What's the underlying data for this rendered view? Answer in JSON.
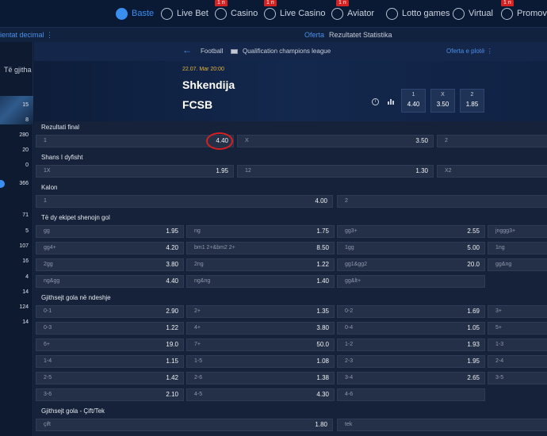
{
  "topnav": [
    {
      "label": "Baste",
      "icon": "soccer-ball-icon",
      "active": true,
      "badge": ""
    },
    {
      "label": "Live Bet",
      "icon": "live-bet-icon",
      "active": false,
      "badge": ""
    },
    {
      "label": "Casino",
      "icon": "casino-chips-icon",
      "active": false,
      "badge": "1 ri"
    },
    {
      "label": "Live Casino",
      "icon": "live-casino-icon",
      "active": false,
      "badge": "1 ri"
    },
    {
      "label": "Aviator",
      "icon": "plane-icon",
      "active": false,
      "badge": "1 ri"
    },
    {
      "label": "Lotto games",
      "icon": "lotto-icon",
      "active": false,
      "badge": ""
    },
    {
      "label": "Virtual",
      "icon": "virtual-icon",
      "active": false,
      "badge": ""
    },
    {
      "label": "Promovim",
      "icon": "promo-icon",
      "active": false,
      "badge": "1 ri"
    }
  ],
  "subnav": {
    "left": "ientat decimal ⋮",
    "tabs": [
      {
        "label": "Oferta",
        "active": true
      },
      {
        "label": "Rezultatet",
        "active": false
      },
      {
        "label": "Statistika",
        "active": false
      }
    ]
  },
  "sidebar": {
    "all_label": "Të gjitha",
    "counts": [
      "15",
      "8",
      "280",
      "20",
      "0",
      "366",
      "71",
      "5",
      "107",
      "16",
      "4",
      "14",
      "124",
      "14"
    ]
  },
  "breadcrumb": {
    "sport": "Football",
    "league": "Qualification champions league",
    "more": "Oferta e plotë ⋮"
  },
  "match": {
    "date": "22.07. Mar 20:00",
    "home": "Shkendija",
    "away": "FCSB",
    "odds": [
      {
        "label": "1",
        "value": "4.40"
      },
      {
        "label": "X",
        "value": "3.50"
      },
      {
        "label": "2",
        "value": "1.85"
      }
    ]
  },
  "markets": [
    {
      "title": "Rezultati final",
      "rows": [
        [
          [
            "1",
            "4.40"
          ],
          [
            "X",
            "3.50"
          ],
          [
            "2",
            ""
          ]
        ]
      ]
    },
    {
      "title": "Shans I dyfisht",
      "rows": [
        [
          [
            "1X",
            "1.95"
          ],
          [
            "12",
            "1.30"
          ],
          [
            "X2",
            ""
          ]
        ]
      ]
    },
    {
      "title": "Kalon",
      "rows": [
        [
          [
            "1",
            "4.00"
          ],
          [
            "2",
            ""
          ]
        ]
      ]
    },
    {
      "title": "Të dy ekipet shenojn gol",
      "rows": [
        [
          [
            "gg",
            "1.95"
          ],
          [
            "ng",
            "1.75"
          ],
          [
            "gg3+",
            "2.55"
          ],
          [
            "jnggg3+",
            ""
          ]
        ],
        [
          [
            "gg4+",
            "4.20"
          ],
          [
            "bm1 2+&bm2 2+",
            "8.50"
          ],
          [
            "1gg",
            "5.00"
          ],
          [
            "1ng",
            ""
          ]
        ],
        [
          [
            "2gg",
            "3.80"
          ],
          [
            "2ng",
            "1.22"
          ],
          [
            "gg1&gg2",
            "20.0"
          ],
          [
            "gg&ng",
            ""
          ]
        ],
        [
          [
            "ng&gg",
            "4.40"
          ],
          [
            "ng&ng",
            "1.40"
          ],
          [
            "gg&lt+",
            ""
          ]
        ]
      ]
    },
    {
      "title": "Gjithsejt gola në ndeshje",
      "rows": [
        [
          [
            "0-1",
            "2.90"
          ],
          [
            "2+",
            "1.35"
          ],
          [
            "0-2",
            "1.69"
          ],
          [
            "3+",
            ""
          ]
        ],
        [
          [
            "0-3",
            "1.22"
          ],
          [
            "4+",
            "3.80"
          ],
          [
            "0-4",
            "1.05"
          ],
          [
            "5+",
            ""
          ]
        ],
        [
          [
            "6+",
            "19.0"
          ],
          [
            "7+",
            "50.0"
          ],
          [
            "1-2",
            "1.93"
          ],
          [
            "1-3",
            ""
          ]
        ],
        [
          [
            "1-4",
            "1.15"
          ],
          [
            "1-5",
            "1.08"
          ],
          [
            "2-3",
            "1.95"
          ],
          [
            "2-4",
            ""
          ]
        ],
        [
          [
            "2-5",
            "1.42"
          ],
          [
            "2-6",
            "1.38"
          ],
          [
            "3-4",
            "2.65"
          ],
          [
            "3-5",
            ""
          ]
        ],
        [
          [
            "3-6",
            "2.10"
          ],
          [
            "4-5",
            "4.30"
          ],
          [
            "4-6",
            ""
          ]
        ]
      ]
    },
    {
      "title": "Gjithsejt gola - Çift/Tek",
      "rows": [
        [
          [
            "çift",
            "1.80"
          ],
          [
            "tek",
            ""
          ]
        ]
      ]
    }
  ]
}
